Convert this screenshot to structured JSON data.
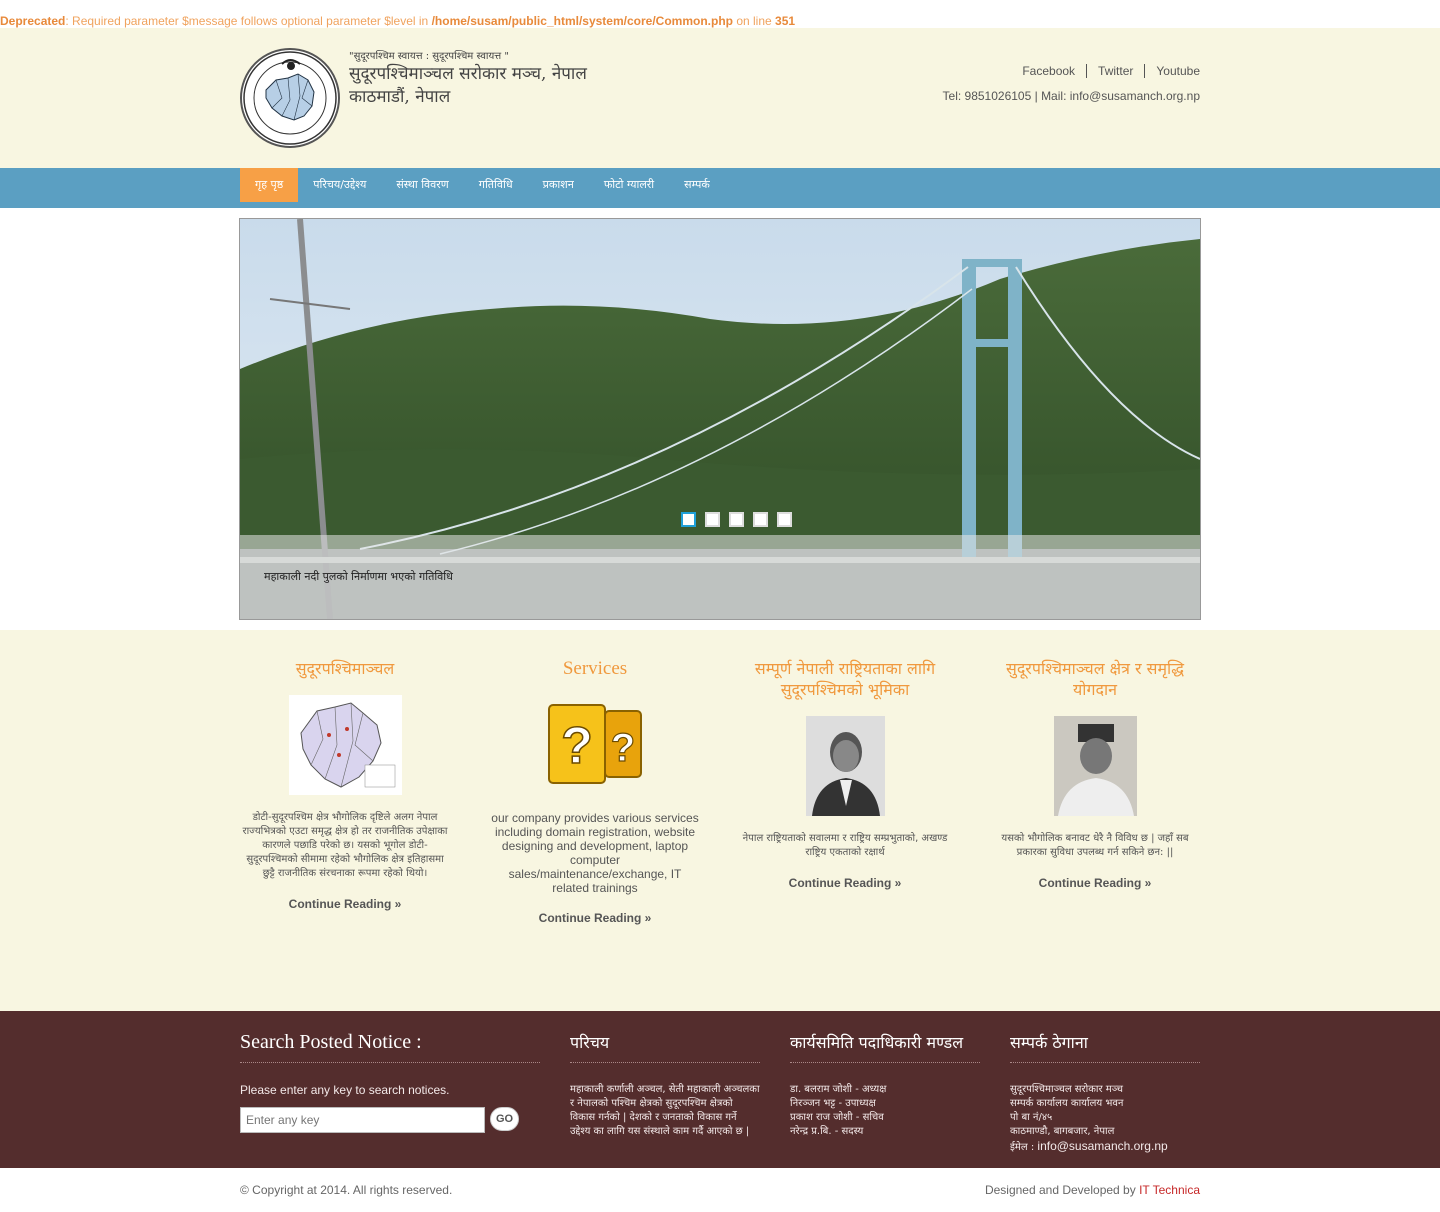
{
  "deprecated": {
    "label": "Deprecated",
    "msg": ": Required parameter $message follows optional parameter $level in ",
    "path": "/home/susam/public_html/system/core/Common.php",
    "online": " on line ",
    "line": "351"
  },
  "header": {
    "slogan": "\"सुदूरपश्चिम स्वायत्त : सुदूरपश्चिम स्वायत्त \"",
    "org_name": "सुदूरपश्चिमाञ्चल सरोकार मञ्च, नेपाल काठमाडौं, नेपाल",
    "social": [
      "Facebook",
      "Twitter",
      "Youtube"
    ],
    "contact": "Tel: 9851026105 | Mail: info@susamanch.org.np"
  },
  "nav": [
    "गृह पृष्ठ",
    "परिचय/उद्देश्य",
    "संस्था विवरण",
    "गतिविधि",
    "प्रकाशन",
    "फोटो ग्यालरी",
    "सम्पर्क"
  ],
  "slider": {
    "caption": "महाकाली नदी पुलको निर्माणमा भएको गतिविधि",
    "dots": 5,
    "active_dot": 1
  },
  "columns": [
    {
      "title": "सुदूरपश्चिमाञ्चल",
      "text": "डोटी-सुदूरपश्चिम क्षेत्र भौगोलिक दृष्टिले अलग नेपाल राज्यभित्रको एउटा समृद्ध क्षेत्र हो तर राजनीतिक उपेक्षाका कारणले पछाडि परेको छ। यसको भूगोल डोटी-सुदूरपश्चिमको सीमामा रहेको भौगोलिक क्षेत्र इतिहासमा छुट्टै राजनीतिक संरचनाका रूपमा रहेको थियो।",
      "more": "Continue Reading »"
    },
    {
      "title": "Services",
      "text": "our company provides various services including domain registration, website designing and development, laptop computer sales/maintenance/exchange, IT related trainings",
      "more": "Continue Reading »"
    },
    {
      "title": "सम्पूर्ण नेपाली राष्ट्रियताका लागि सुदूरपश्चिमको भूमिका",
      "text": "नेपाल राष्ट्रियताको सवालमा र राष्ट्रिय सम्प्रभुताको, अखण्ड राष्ट्रिय एकताको रक्षार्थ",
      "more": "Continue Reading »"
    },
    {
      "title": "सुदूरपश्चिमाञ्चल क्षेत्र र समृद्धि योगदान",
      "text": "यसको भौगोलिक बनावट धेरै नै विविध छ | जहाँ सब प्रकारका सुविधा उपलब्ध गर्न सकिने छन: ||",
      "more": "Continue Reading »"
    }
  ],
  "footer": {
    "search_title": "Search Posted Notice :",
    "search_hint": "Please enter any key to search notices.",
    "search_placeholder": "Enter any key",
    "go": "GO",
    "about_title": "परिचय",
    "about_text": "महाकाली कर्णाली अञ्चल, सेती महाकाली अञ्चलका र नेपालको पश्चिम क्षेत्रको सुदूरपश्चिम क्षेत्रको विकास गर्नको | देशको र जनताको विकास गर्ने उद्देश्य का लागि यस संस्थाले काम गर्दै आएको छ |",
    "members_title": "कार्यसमिति पदाधिकारी मण्डल",
    "members": [
      "डा. बलराम जोशी - अध्यक्ष",
      "निरञ्जन भट्ट - उपाध्यक्ष",
      "प्रकाश राज जोशी - सचिव",
      "नरेन्द्र प्र.बि. - सदस्य"
    ],
    "contact_title": "सम्पर्क ठेगाना",
    "contact_lines": [
      "सुदूरपश्चिमाञ्चल सरोकार मञ्च",
      "सम्पर्क कार्यालय कार्यालय भवन",
      "पो बा नं/४५",
      "काठमाण्डौ, बागबजार, नेपाल"
    ],
    "email_label": "ईमेल : ",
    "email": "info@susamanch.org.np"
  },
  "bottom": {
    "copyright": "© Copyright at 2014. All rights reserved.",
    "designed": "Designed and Developed by ",
    "company": "IT Technica"
  }
}
